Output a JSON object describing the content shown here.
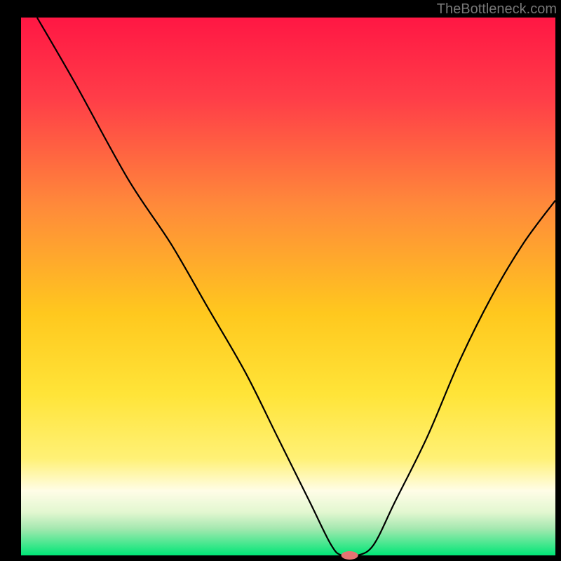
{
  "attribution": "TheBottleneck.com",
  "chart_data": {
    "type": "line",
    "title": "",
    "xlabel": "",
    "ylabel": "",
    "xlim": [
      0,
      100
    ],
    "ylim": [
      0,
      100
    ],
    "background": {
      "type": "vertical-gradient",
      "stops": [
        {
          "offset": 0,
          "color": "#ff1744"
        },
        {
          "offset": 15,
          "color": "#ff3d48"
        },
        {
          "offset": 35,
          "color": "#ff8a3a"
        },
        {
          "offset": 55,
          "color": "#ffc81e"
        },
        {
          "offset": 70,
          "color": "#ffe438"
        },
        {
          "offset": 82,
          "color": "#fff176"
        },
        {
          "offset": 88,
          "color": "#fffde7"
        },
        {
          "offset": 92,
          "color": "#e2f7d0"
        },
        {
          "offset": 95,
          "color": "#a5e8b0"
        },
        {
          "offset": 100,
          "color": "#00e676"
        }
      ]
    },
    "series": [
      {
        "name": "bottleneck-curve",
        "x": [
          3,
          10,
          20,
          28,
          35,
          42,
          48,
          54,
          58,
          60,
          63,
          66,
          70,
          76,
          82,
          88,
          94,
          100
        ],
        "y": [
          100,
          88,
          70,
          58,
          46,
          34,
          22,
          10,
          2,
          0,
          0,
          2,
          10,
          22,
          36,
          48,
          58,
          66
        ]
      }
    ],
    "marker": {
      "name": "optimal-point",
      "x": 61.5,
      "y": 0,
      "color": "#e57373",
      "rx": 12,
      "ry": 6
    },
    "frame": {
      "left_width": 30,
      "right_width": 8,
      "top": 25,
      "bottom": 8,
      "color": "#000000"
    }
  }
}
